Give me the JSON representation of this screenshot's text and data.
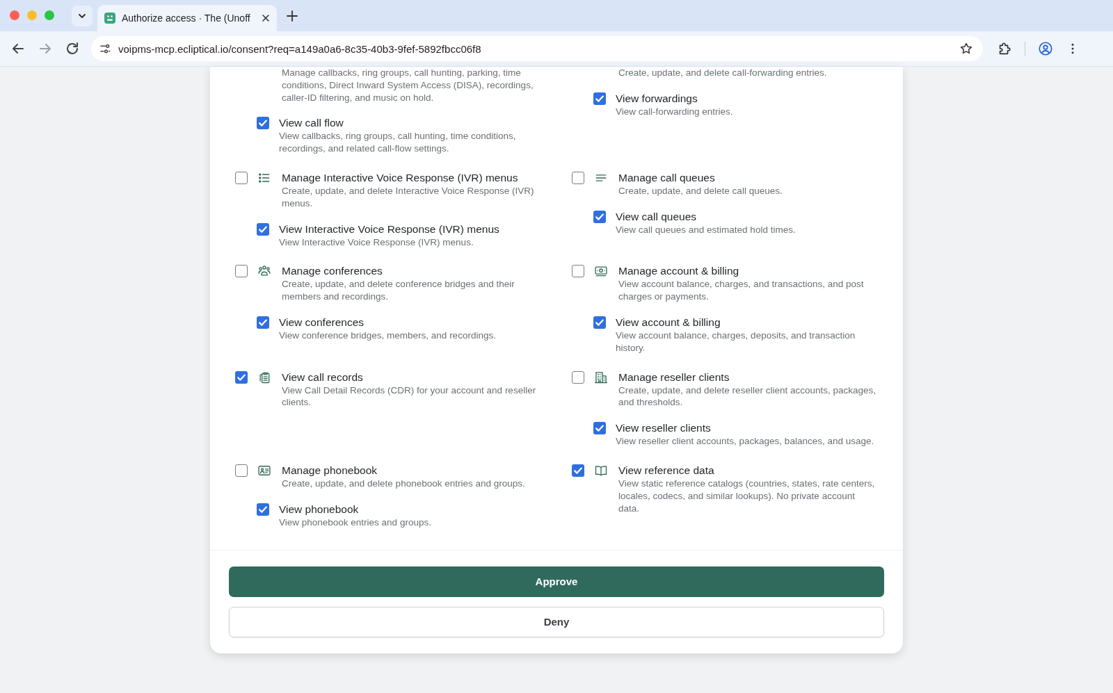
{
  "browser": {
    "tab_title": "Authorize access · The (Unoff",
    "url": "voipms-mcp.ecliptical.io/consent?req=a149a0a6-8c35-40b3-9fef-5892fbcc06f8"
  },
  "scopes": [
    {
      "description": "Manage callbacks, ring groups, call hunting, parking, time conditions, Direct Inward System Access (DISA), recordings, caller-ID filtering, and music on hold.",
      "children": [
        {
          "title": "View call flow",
          "description": "View callbacks, ring groups, call hunting, time conditions, recordings, and related call-flow settings.",
          "checked": true
        }
      ]
    },
    {
      "description": "Create, update, and delete call-forwarding entries.",
      "children": [
        {
          "title": "View forwardings",
          "description": "View call-forwarding entries.",
          "checked": true
        }
      ]
    },
    {
      "kind": "ivr",
      "title": "Manage Interactive Voice Response (IVR) menus",
      "description": "Create, update, and delete Interactive Voice Response (IVR) menus.",
      "checked": false,
      "children": [
        {
          "title": "View Interactive Voice Response (IVR) menus",
          "description": "View Interactive Voice Response (IVR) menus.",
          "checked": true
        }
      ]
    },
    {
      "kind": "queues",
      "title": "Manage call queues",
      "description": "Create, update, and delete call queues.",
      "checked": false,
      "children": [
        {
          "title": "View call queues",
          "description": "View call queues and estimated hold times.",
          "checked": true
        }
      ]
    },
    {
      "kind": "conferences",
      "title": "Manage conferences",
      "description": "Create, update, and delete conference bridges and their members and recordings.",
      "checked": false,
      "children": [
        {
          "title": "View conferences",
          "description": "View conference bridges, members, and recordings.",
          "checked": true
        }
      ]
    },
    {
      "kind": "billing",
      "title": "Manage account & billing",
      "description": "View account balance, charges, and transactions, and post charges or payments.",
      "checked": false,
      "children": [
        {
          "title": "View account & billing",
          "description": "View account balance, charges, deposits, and transaction history.",
          "checked": true
        }
      ]
    },
    {
      "kind": "records",
      "title": "View call records",
      "description": "View Call Detail Records (CDR) for your account and reseller clients.",
      "checked": true
    },
    {
      "kind": "reseller",
      "title": "Manage reseller clients",
      "description": "Create, update, and delete reseller client accounts, packages, and thresholds.",
      "checked": false,
      "children": [
        {
          "title": "View reseller clients",
          "description": "View reseller client accounts, packages, balances, and usage.",
          "checked": true
        }
      ]
    },
    {
      "kind": "phonebook",
      "title": "Manage phonebook",
      "description": "Create, update, and delete phonebook entries and groups.",
      "checked": false,
      "children": [
        {
          "title": "View phonebook",
          "description": "View phonebook entries and groups.",
          "checked": true
        }
      ]
    },
    {
      "kind": "reference",
      "title": "View reference data",
      "description": "View static reference catalogs (countries, states, rate centers, locales, codecs, and similar lookups). No private account data.",
      "checked": true
    }
  ],
  "buttons": [
    {
      "label": "Approve",
      "kind": "primary"
    },
    {
      "label": "Deny",
      "kind": "secondary"
    }
  ]
}
